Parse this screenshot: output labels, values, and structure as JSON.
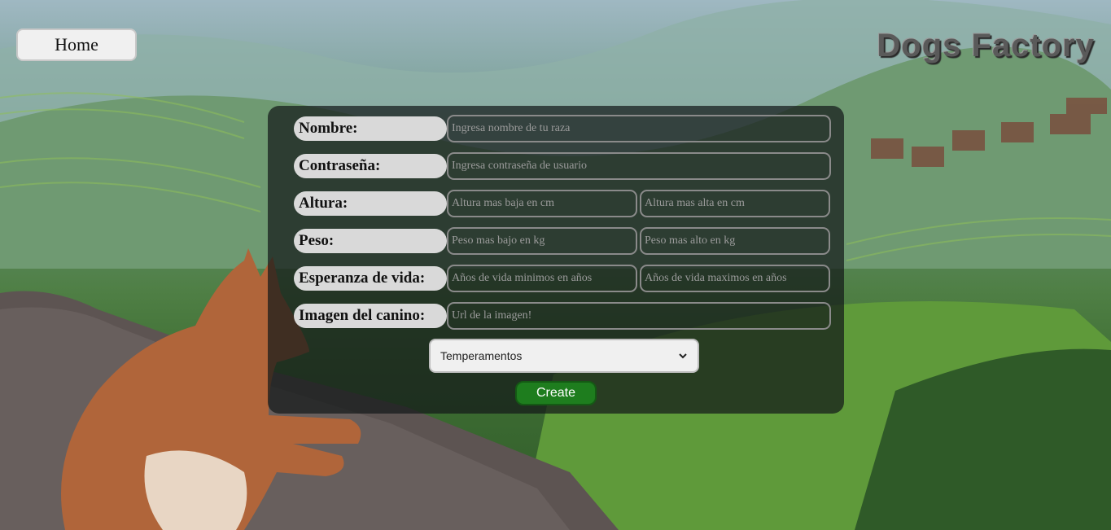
{
  "nav": {
    "home_label": "Home"
  },
  "brand": {
    "title": "Dogs Factory"
  },
  "form": {
    "nombre": {
      "label": "Nombre:",
      "placeholder": "Ingresa nombre de tu raza"
    },
    "contrasena": {
      "label": "Contraseña:",
      "placeholder": "Ingresa contraseña de usuario"
    },
    "altura": {
      "label": "Altura:",
      "min_placeholder": "Altura mas baja en cm",
      "max_placeholder": "Altura mas alta en cm"
    },
    "peso": {
      "label": "Peso:",
      "min_placeholder": "Peso mas bajo en kg",
      "max_placeholder": "Peso mas alto en kg"
    },
    "vida": {
      "label": "Esperanza de vida:",
      "min_placeholder": "Años de vida minimos en años",
      "max_placeholder": "Años de vida maximos en años"
    },
    "imagen": {
      "label": "Imagen del canino:",
      "placeholder": "Url de la imagen!"
    },
    "temperamentos": {
      "selected": "Temperamentos"
    },
    "create_label": "Create"
  },
  "colors": {
    "create": "#1e7d1e",
    "panel": "#141919"
  },
  "icons": {
    "select_arrow": "chevron-down-icon"
  }
}
